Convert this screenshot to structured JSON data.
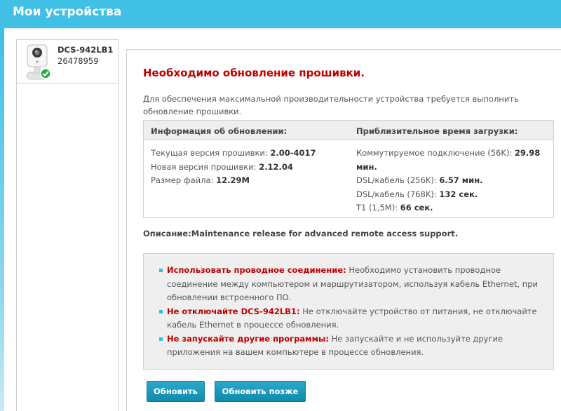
{
  "header": {
    "title": "Мои устройства"
  },
  "device": {
    "name": "DCS-942LB1",
    "serial": "26478959"
  },
  "firmware": {
    "heading": "Необходимо обновление прошивки.",
    "intro": "Для обеспечения максимальной производительности устройства требуется выполнить обновление прошивки.",
    "info": {
      "left_header": "Информация об обновлении:",
      "right_header": "Приблизительное время загрузки:",
      "current_label": "Текущая версия прошивки:",
      "current_value": "2.00-4017",
      "new_label": "Новая версия прошивки:",
      "new_value": "2.12.04",
      "size_label": "Размер файла:",
      "size_value": "12.29M",
      "dialup_label": "Коммутируемое подключение (56K):",
      "dialup_value": "29.98 мин.",
      "dsl256_label": "DSL/кабель (256K):",
      "dsl256_value": "6.57 мин.",
      "dsl768_label": "DSL/кабель (768K):",
      "dsl768_value": "132 сек.",
      "t1_label": "T1 (1,5M):",
      "t1_value": "66 сек."
    },
    "description": "Описание:Maintenance release for advanced remote access support.",
    "notices": [
      {
        "title": "Использовать проводное соединение:",
        "text": " Необходимо установить проводное соединение между компьютером и маршрутизатором, используя кабель Ethernet, при обновлении встроенного ПО."
      },
      {
        "title": "Не отключайте DCS-942LB1:",
        "text": " Не отключайте устройство от питания, не отключайте кабель Ethernet в процессе обновления."
      },
      {
        "title": "Не запускайте другие программы:",
        "text": " Не запускайте и не используйте другие приложения на вашем компьютере в процессе обновления."
      }
    ],
    "buttons": {
      "update": "Обновить",
      "later": "Обновить позже"
    }
  },
  "colors": {
    "header_bar": "#40c0e4",
    "warning": "#c00000",
    "button": "#1a96b8",
    "bullet": "#3bb8e0"
  },
  "icons": {
    "device": "camera-icon",
    "status": "check-badge-icon"
  }
}
